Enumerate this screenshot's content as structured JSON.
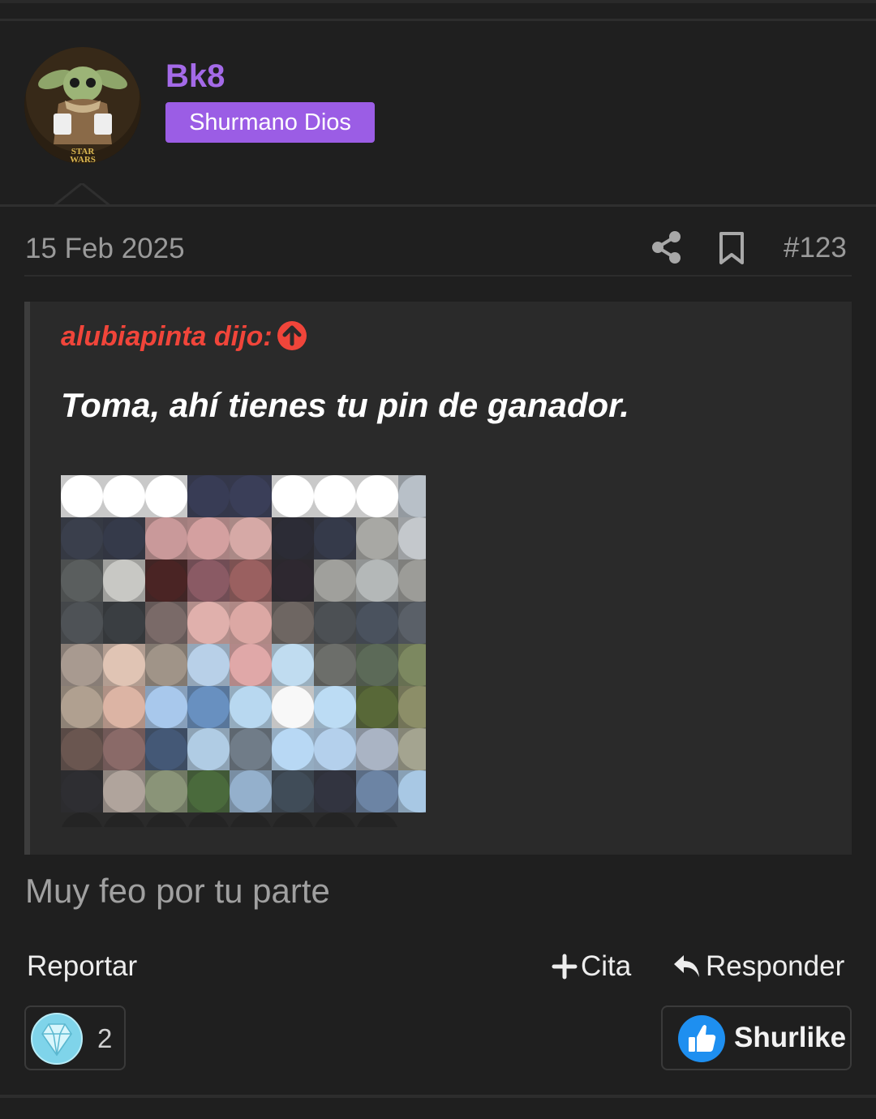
{
  "post": {
    "username": "Bk8",
    "user_title": "Shurmano Dios",
    "date": "15 Feb 2025",
    "number": "#123",
    "body": "Muy feo por tu parte"
  },
  "quote": {
    "author_label": "alubiapinta dijo:",
    "text": "Toma, ahí tienes tu pin de ganador."
  },
  "actions": {
    "report": "Reportar",
    "cite": "Cita",
    "reply": "Responder",
    "like": "Shurlike"
  },
  "reactions": {
    "count": "2"
  },
  "colors": {
    "username": "#a46ae8",
    "user_title_bg": "#9b5de5",
    "quote_author": "#f0453a",
    "like_blue": "#1e8ff0"
  },
  "icons": [
    "share-icon",
    "bookmark-icon",
    "arrow-up-circle-icon",
    "plus-icon",
    "reply-arrow-icon",
    "diamond-icon",
    "thumbs-up-icon"
  ]
}
